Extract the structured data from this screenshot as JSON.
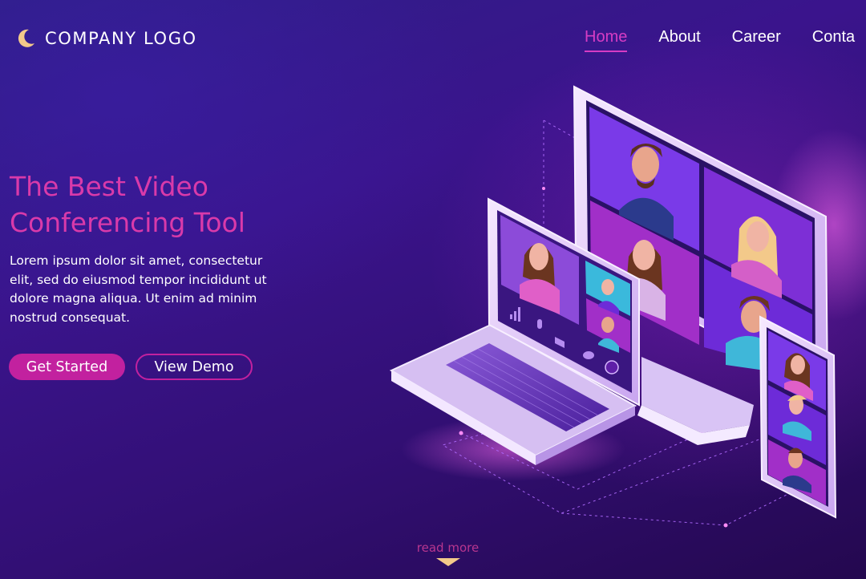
{
  "header": {
    "logo_text": "COMPANY LOGO",
    "nav": [
      {
        "label": "Home",
        "active": true
      },
      {
        "label": "About",
        "active": false
      },
      {
        "label": "Career",
        "active": false
      },
      {
        "label": "Conta",
        "active": false
      }
    ]
  },
  "hero": {
    "title_line1": "The Best Video",
    "title_line2": "Conferencing Tool",
    "body": "Lorem ipsum dolor sit amet, consectetur elit, sed do eiusmod tempor incididunt ut dolore magna aliqua. Ut enim ad minim nostrud consequat.",
    "primary_button": "Get Started",
    "secondary_button": "View Demo"
  },
  "footer": {
    "read_more": "read more"
  },
  "colors": {
    "accent": "#c2219f",
    "title": "#d93aaa",
    "logo_mark": "#f3c98a"
  },
  "icons": [
    "crescent-moon-icon",
    "chevron-down-icon",
    "signal-icon",
    "microphone-icon",
    "camera-icon",
    "chat-icon",
    "end-call-icon"
  ]
}
